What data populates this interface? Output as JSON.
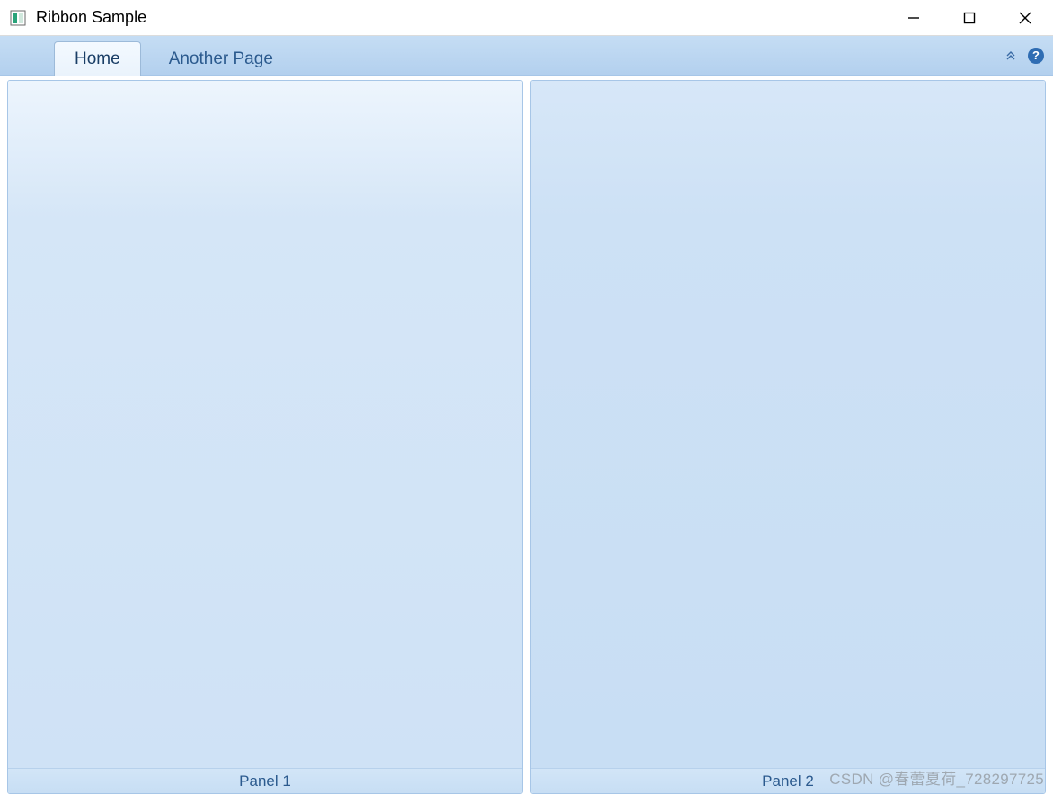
{
  "window": {
    "title": "Ribbon Sample"
  },
  "ribbon": {
    "tabs": [
      {
        "label": "Home",
        "active": true
      },
      {
        "label": "Another Page",
        "active": false
      }
    ],
    "collapse_tooltip": "Collapse",
    "help_label": "?"
  },
  "panels": [
    {
      "caption": "Panel 1"
    },
    {
      "caption": "Panel 2"
    }
  ],
  "watermark": "CSDN @春蕾夏荷_728297725"
}
